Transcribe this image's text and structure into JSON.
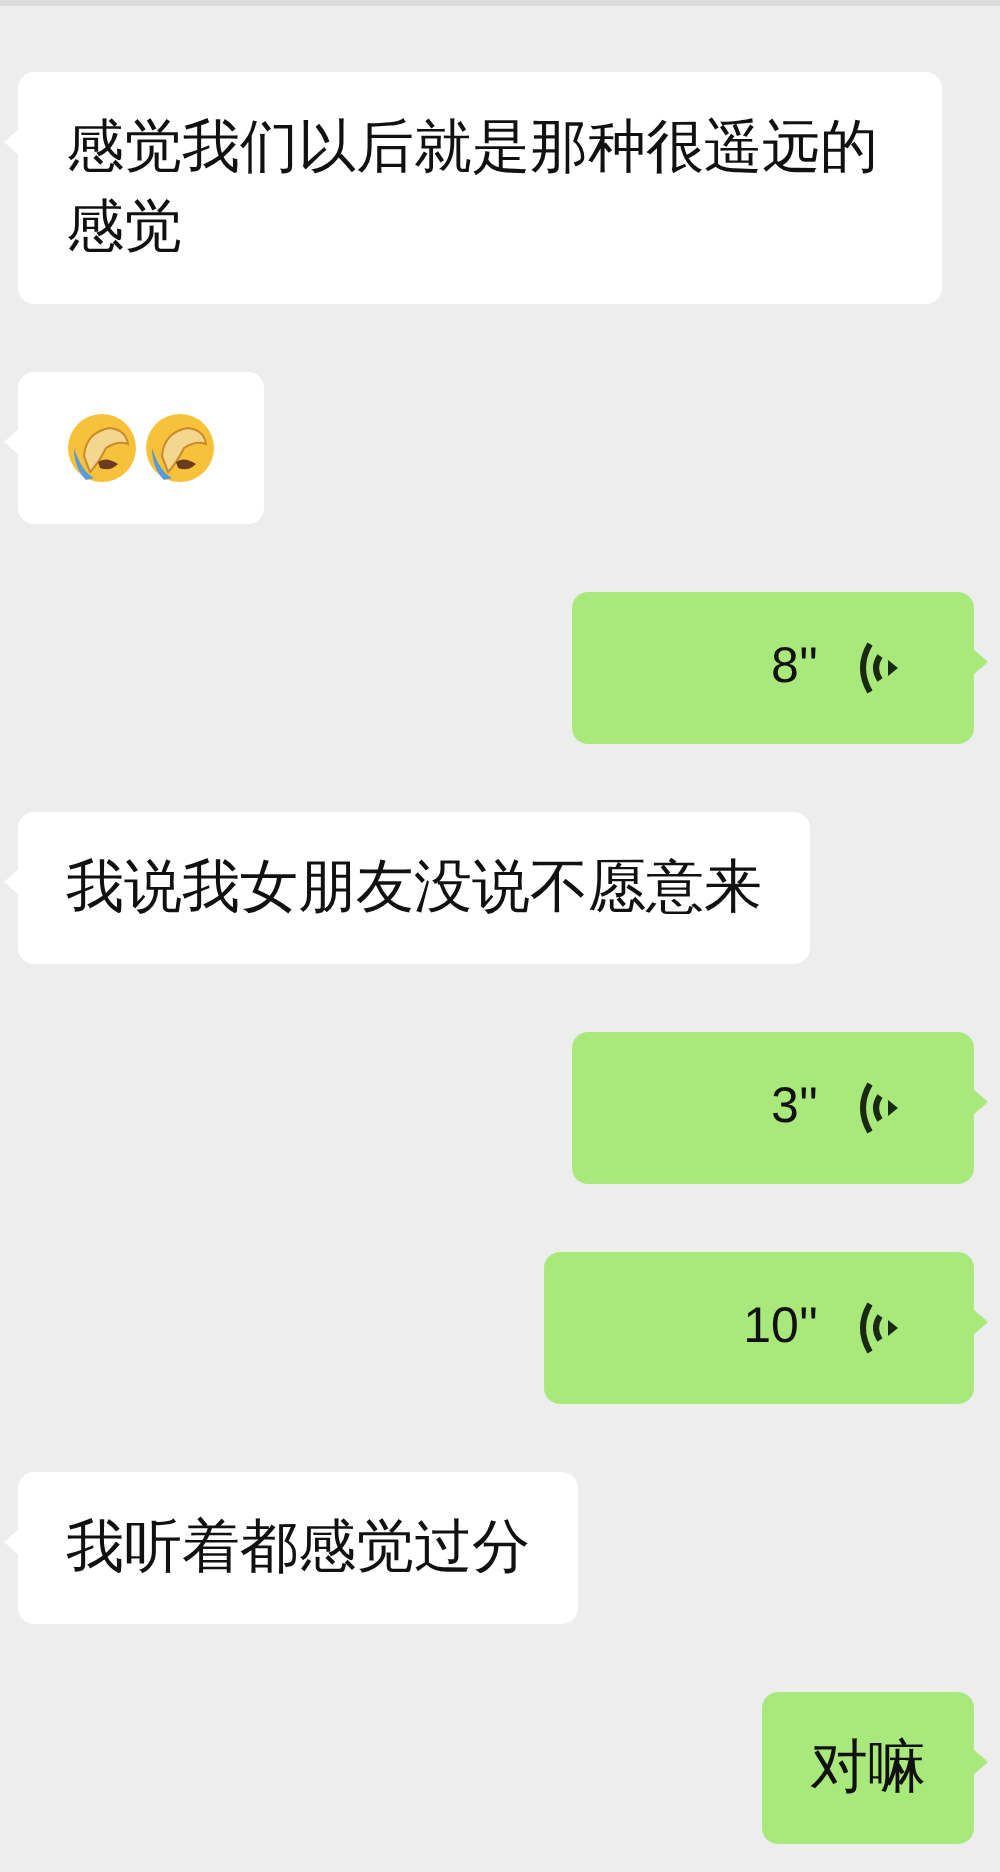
{
  "messages": [
    {
      "kind": "text",
      "outgoing": false,
      "text": "感觉我们以后就是那种很遥远的感觉"
    },
    {
      "kind": "emoji",
      "outgoing": false,
      "emojis": [
        {
          "kind": "facepalm"
        },
        {
          "kind": "facepalm"
        }
      ]
    },
    {
      "kind": "voice",
      "outgoing": true,
      "duration": "8''"
    },
    {
      "kind": "text",
      "outgoing": false,
      "text": "我说我女朋友没说不愿意来"
    },
    {
      "kind": "voice",
      "outgoing": true,
      "duration": "3''"
    },
    {
      "kind": "voice",
      "outgoing": true,
      "duration": "10''"
    },
    {
      "kind": "text",
      "outgoing": false,
      "text": "我听着都感觉过分"
    },
    {
      "kind": "text",
      "outgoing": true,
      "text": "对嘛"
    }
  ]
}
